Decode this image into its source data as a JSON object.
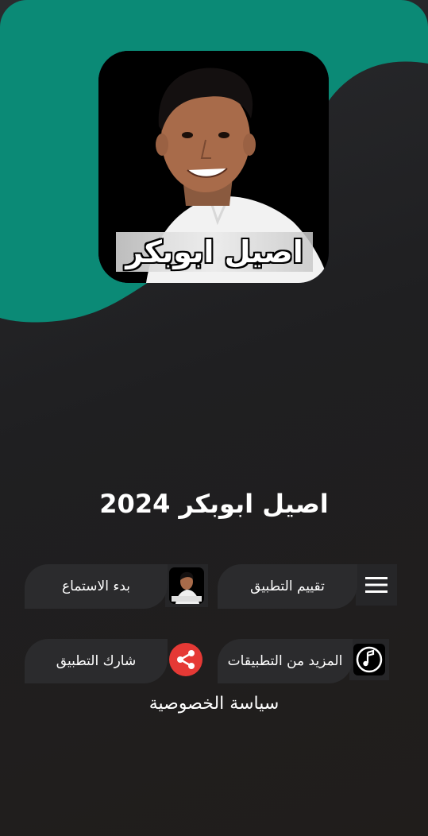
{
  "cover": {
    "caption": "اصيل ابوبكر"
  },
  "app_title": "اصيل ابوبكر 2024",
  "menu": {
    "rate_label": "تقييم التطبيق",
    "start_label": "بدء الاستماع",
    "more_apps_label": "المزيد من التطبيقات",
    "share_label": "شارك  التطبيق"
  },
  "privacy_label": "سياسة الخصوصية",
  "colors": {
    "teal": "#0b8a76",
    "background": "#222224",
    "pill": "#2b2b2d",
    "share_red": "#e53935"
  },
  "icons": {
    "menu": "hamburger-icon",
    "start": "artist-thumbnail",
    "more_apps": "music-note-icon",
    "share": "share-icon"
  }
}
